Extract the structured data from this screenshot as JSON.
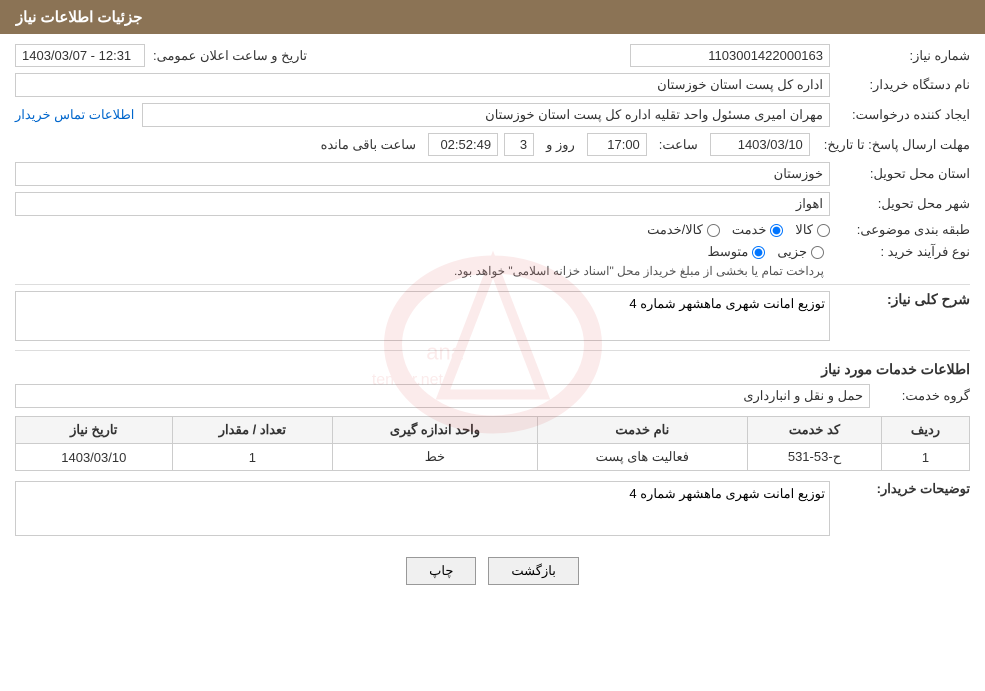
{
  "header": {
    "title": "جزئیات اطلاعات نیاز"
  },
  "fields": {
    "need_number_label": "شماره نیاز:",
    "need_number_value": "1103001422000163",
    "buyer_org_label": "نام دستگاه خریدار:",
    "buyer_org_value": "اداره کل پست استان خوزستان",
    "creator_label": "ایجاد کننده درخواست:",
    "creator_value": "مهران امیری مسئول واحد تقلیه اداره کل پست استان خوزستان",
    "contact_link": "اطلاعات تماس خریدار",
    "deadline_label": "مهلت ارسال پاسخ: تا تاریخ:",
    "deadline_date": "1403/03/10",
    "deadline_time_label": "ساعت:",
    "deadline_time": "17:00",
    "deadline_days_label": "روز و",
    "deadline_days": "3",
    "deadline_remaining_label": "ساعت باقی مانده",
    "deadline_remaining": "02:52:49",
    "announce_label": "تاریخ و ساعت اعلان عمومی:",
    "announce_value": "1403/03/07 - 12:31",
    "province_label": "استان محل تحویل:",
    "province_value": "خوزستان",
    "city_label": "شهر محل تحویل:",
    "city_value": "اهواز",
    "category_label": "طبقه بندی موضوعی:",
    "category_options": [
      {
        "label": "کالا",
        "selected": false
      },
      {
        "label": "خدمت",
        "selected": true
      },
      {
        "label": "کالا/خدمت",
        "selected": false
      }
    ],
    "purchase_type_label": "نوع فرآیند خرید :",
    "purchase_type_options": [
      {
        "label": "جزیی",
        "selected": false
      },
      {
        "label": "متوسط",
        "selected": true
      }
    ],
    "purchase_type_note": "پرداخت تمام یا بخشی از مبلغ خریداز محل \"اسناد خزانه اسلامی\" خواهد بود.",
    "need_desc_label": "شرح کلی نیاز:",
    "need_desc_value": "توزیع امانت شهری ماهشهر شماره 4",
    "services_title": "اطلاعات خدمات مورد نیاز",
    "service_group_label": "گروه خدمت:",
    "service_group_value": "حمل و نقل و انبارداری",
    "table": {
      "headers": [
        "ردیف",
        "کد خدمت",
        "نام خدمت",
        "واحد اندازه گیری",
        "تعداد / مقدار",
        "تاریخ نیاز"
      ],
      "rows": [
        {
          "row": "1",
          "code": "ح-53-531",
          "name": "فعالیت های پست",
          "unit": "خط",
          "qty": "1",
          "date": "1403/03/10"
        }
      ]
    },
    "buyer_notes_label": "توضیحات خریدار:",
    "buyer_notes_value": "توزیع امانت شهری ماهشهر شماره 4"
  },
  "buttons": {
    "print": "چاپ",
    "back": "بازگشت"
  }
}
